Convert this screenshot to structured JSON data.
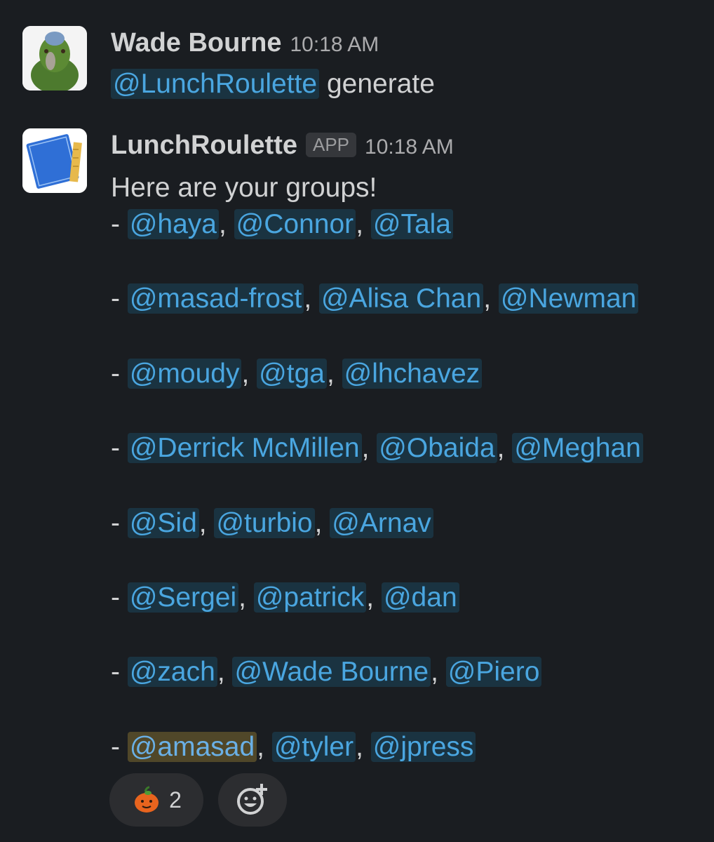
{
  "message1": {
    "author": "Wade Bourne",
    "time": "10:18 AM",
    "mention": "@LunchRoulette",
    "text": " generate"
  },
  "message2": {
    "author": "LunchRoulette",
    "badge": "APP",
    "time": "10:18 AM",
    "intro": "Here are your groups!",
    "groups": [
      [
        "@haya",
        "@Connor",
        "@Tala"
      ],
      [
        "@masad-frost",
        "@Alisa Chan",
        "@Newman"
      ],
      [
        "@moudy",
        "@tga",
        "@lhchavez"
      ],
      [
        "@Derrick McMillen",
        "@Obaida",
        "@Meghan"
      ],
      [
        "@Sid",
        "@turbio",
        "@Arnav"
      ],
      [
        "@Sergei",
        "@patrick",
        "@dan"
      ],
      [
        "@zach",
        "@Wade Bourne",
        "@Piero"
      ],
      [
        "@amasad",
        "@tyler",
        "@jpress"
      ]
    ]
  },
  "reactions": [
    {
      "icon": "pumpkin-emoji-icon",
      "count": "2"
    }
  ],
  "add_reaction_icon": "add-reaction-icon",
  "colors": {
    "background": "#1a1d21",
    "mention_text": "#4aa6e0",
    "mention_bg": "#1d3a4f",
    "self_mention_bg": "#4a4023"
  }
}
